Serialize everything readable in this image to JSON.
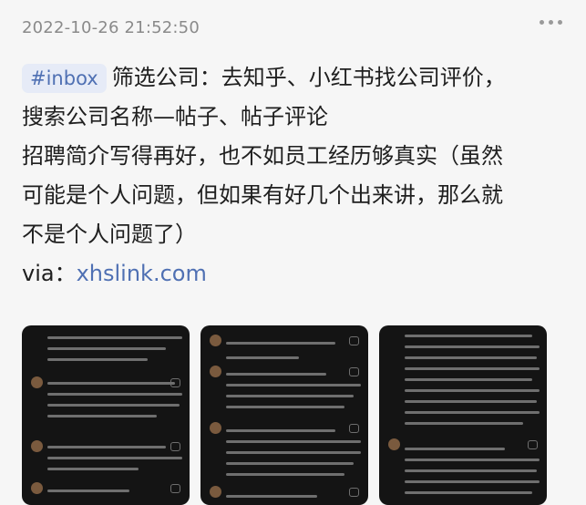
{
  "post": {
    "timestamp": "2022-10-26 21:52:50",
    "tag": "#inbox",
    "line1": "筛选公司：去知乎、小红书找公司评价，",
    "line2": "搜索公司名称—帖子、帖子评论",
    "line3": "招聘简介写得再好，也不如员工经历够真实（虽然",
    "line4": "可能是个人问题，但如果有好几个出来讲，那么就",
    "line5": "不是个人问题了）",
    "via_label": "via：",
    "via_link": "xhslink.com"
  },
  "icons": {
    "more": "more-horizontal-icon"
  },
  "colors": {
    "accent": "#4f70b3",
    "tag_bg": "#e6ebf7",
    "text": "#1f1f1f",
    "muted": "#8a8a8a"
  },
  "thumbnails": [
    {
      "name": "screenshot-1"
    },
    {
      "name": "screenshot-2"
    },
    {
      "name": "screenshot-3"
    }
  ]
}
